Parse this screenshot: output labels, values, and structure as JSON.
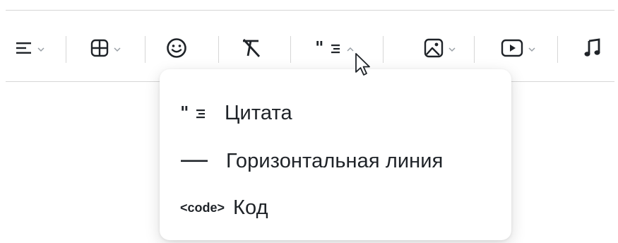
{
  "toolbar": {
    "items": [
      {
        "icon": "align-left-icon"
      },
      {
        "icon": "table-icon"
      },
      {
        "icon": "emoji-icon"
      },
      {
        "icon": "clear-format-icon"
      },
      {
        "icon": "quote-block-icon"
      },
      {
        "icon": "image-icon"
      },
      {
        "icon": "video-icon"
      },
      {
        "icon": "audio-icon"
      }
    ]
  },
  "dropdown": {
    "items": [
      {
        "label": "Цитата",
        "icon": "quote-block-icon"
      },
      {
        "label": "Горизонтальная линия",
        "icon": "horizontal-line-icon"
      },
      {
        "label": "Код",
        "icon": "code-icon",
        "icon_text": "<code>"
      }
    ]
  },
  "colors": {
    "text": "#1f2328",
    "separator": "#d6d6d6",
    "chevron": "#9aa0a6"
  }
}
